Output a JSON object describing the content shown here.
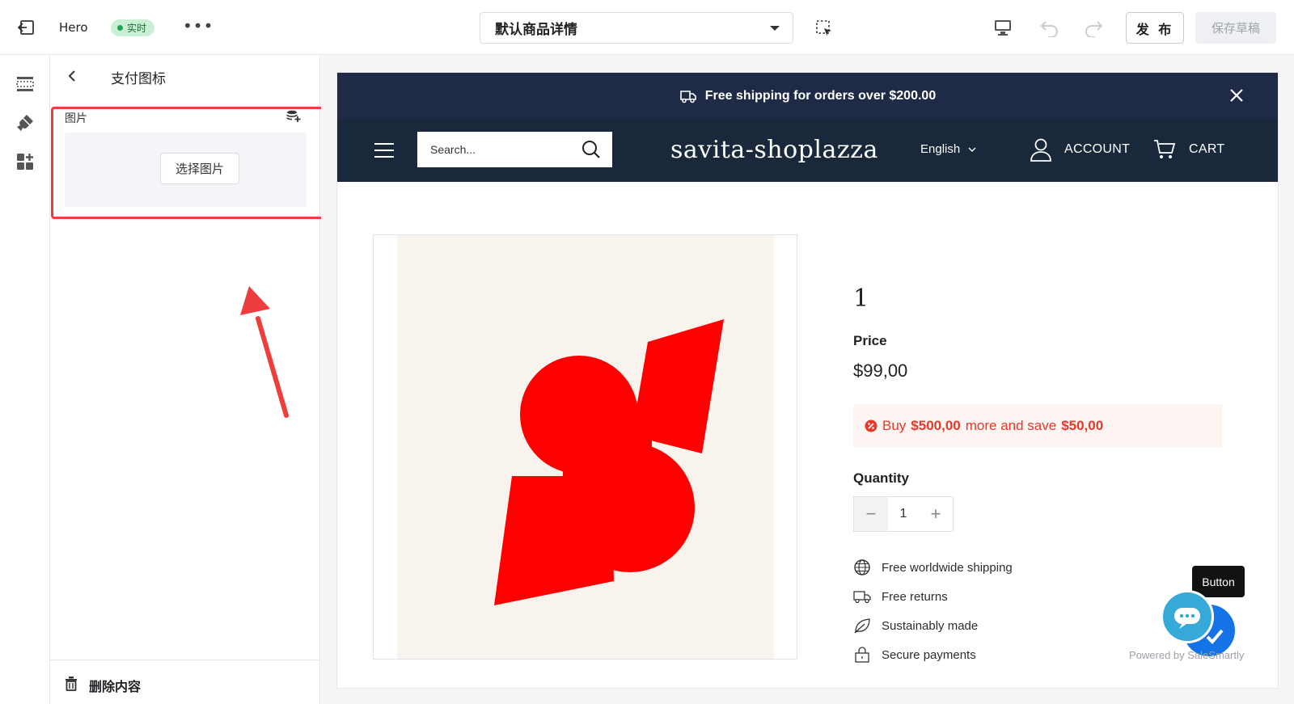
{
  "topbar": {
    "title": "Hero",
    "status_badge": "实时",
    "more": "•••",
    "template_select": "默认商品详情",
    "publish_label": "发 布",
    "save_draft_label": "保存草稿"
  },
  "panel": {
    "title": "支付图标",
    "image_field_label": "图片",
    "choose_image_label": "选择图片",
    "delete_label": "删除内容"
  },
  "store": {
    "announcement": "Free shipping for orders over $200.00",
    "search_placeholder": "Search...",
    "logo": "savita-shoplazza",
    "language": "English",
    "account_label": "ACCOUNT",
    "cart_label": "CART",
    "product": {
      "title": "1",
      "price_label": "Price",
      "price": "$99,00",
      "promo_prefix": "Buy",
      "promo_amount": "$500,00",
      "promo_middle": "more and save",
      "promo_save": "$50,00",
      "quantity_label": "Quantity",
      "quantity": "1"
    },
    "features": [
      {
        "label": "Free worldwide shipping",
        "icon": "globe-icon"
      },
      {
        "label": "Free returns",
        "icon": "truck-icon"
      },
      {
        "label": "Sustainably made",
        "icon": "leaf-icon"
      },
      {
        "label": "Secure payments",
        "icon": "lock-icon"
      }
    ],
    "chat_tooltip": "Button",
    "powered_by": "Powered by SaleSmartly"
  },
  "colors": {
    "highlight": "#ee3d3d",
    "announcement_bg": "#1f2a47",
    "header_bg": "#19283a",
    "promo_text": "#e8372b",
    "badge_bg": "#c9f0d5"
  }
}
